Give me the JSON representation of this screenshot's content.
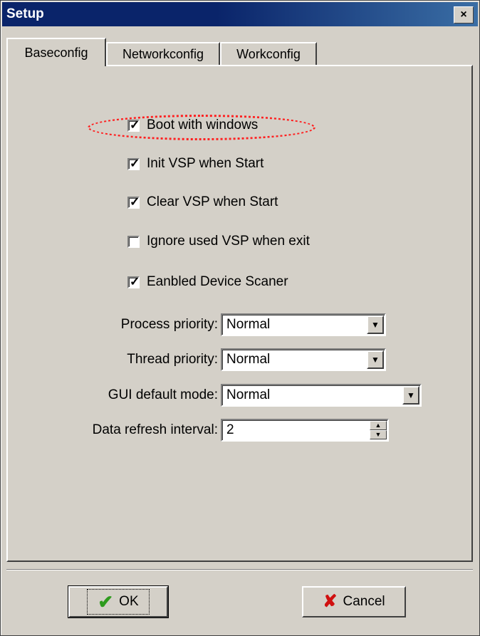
{
  "window": {
    "title": "Setup",
    "close_glyph": "×"
  },
  "tabs": [
    {
      "label": "Baseconfig",
      "active": true
    },
    {
      "label": "Networkconfig",
      "active": false
    },
    {
      "label": "Workconfig",
      "active": false
    }
  ],
  "checkboxes": [
    {
      "label": "Boot with windows",
      "checked": true,
      "highlighted": true
    },
    {
      "label": "Init VSP when Start",
      "checked": true
    },
    {
      "label": "Clear VSP when Start",
      "checked": true
    },
    {
      "label": "Ignore used VSP when exit",
      "checked": false
    },
    {
      "label": "Eanbled Device Scaner",
      "checked": true
    }
  ],
  "fields": {
    "process_priority": {
      "label": "Process priority:",
      "value": "Normal"
    },
    "thread_priority": {
      "label": "Thread priority:",
      "value": "Normal"
    },
    "gui_default_mode": {
      "label": "GUI default mode:",
      "value": "Normal"
    },
    "data_refresh_interval": {
      "label": "Data refresh interval:",
      "value": "2"
    }
  },
  "buttons": {
    "ok": "OK",
    "cancel": "Cancel"
  },
  "icons": {
    "ok": "checkmark-icon",
    "cancel": "x-icon",
    "dropdown": "chevron-down-icon",
    "close": "close-icon"
  },
  "colors": {
    "title_bar": "#0a246a",
    "highlight": "#ff2020",
    "ok_icon": "#2e9b1e",
    "cancel_icon": "#d01010"
  }
}
